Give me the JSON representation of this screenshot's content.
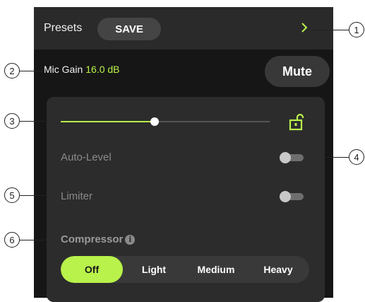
{
  "header": {
    "presets_label": "Presets",
    "save_label": "SAVE"
  },
  "gain": {
    "label": "Mic Gain",
    "value": "16.0 dB"
  },
  "mute_label": "Mute",
  "slider": {
    "level": 0.45
  },
  "options": [
    {
      "label": "Auto-Level",
      "on": false
    },
    {
      "label": "Limiter",
      "on": false
    }
  ],
  "compressor": {
    "label": "Compressor",
    "info_glyph": "i",
    "options": [
      "Off",
      "Light",
      "Medium",
      "Heavy"
    ],
    "selected": "Off"
  },
  "callouts": [
    "1",
    "2",
    "3",
    "4",
    "5",
    "6"
  ],
  "colors": {
    "accent": "#b9f24a",
    "panel": "#161616",
    "card": "#2c2c2c"
  }
}
